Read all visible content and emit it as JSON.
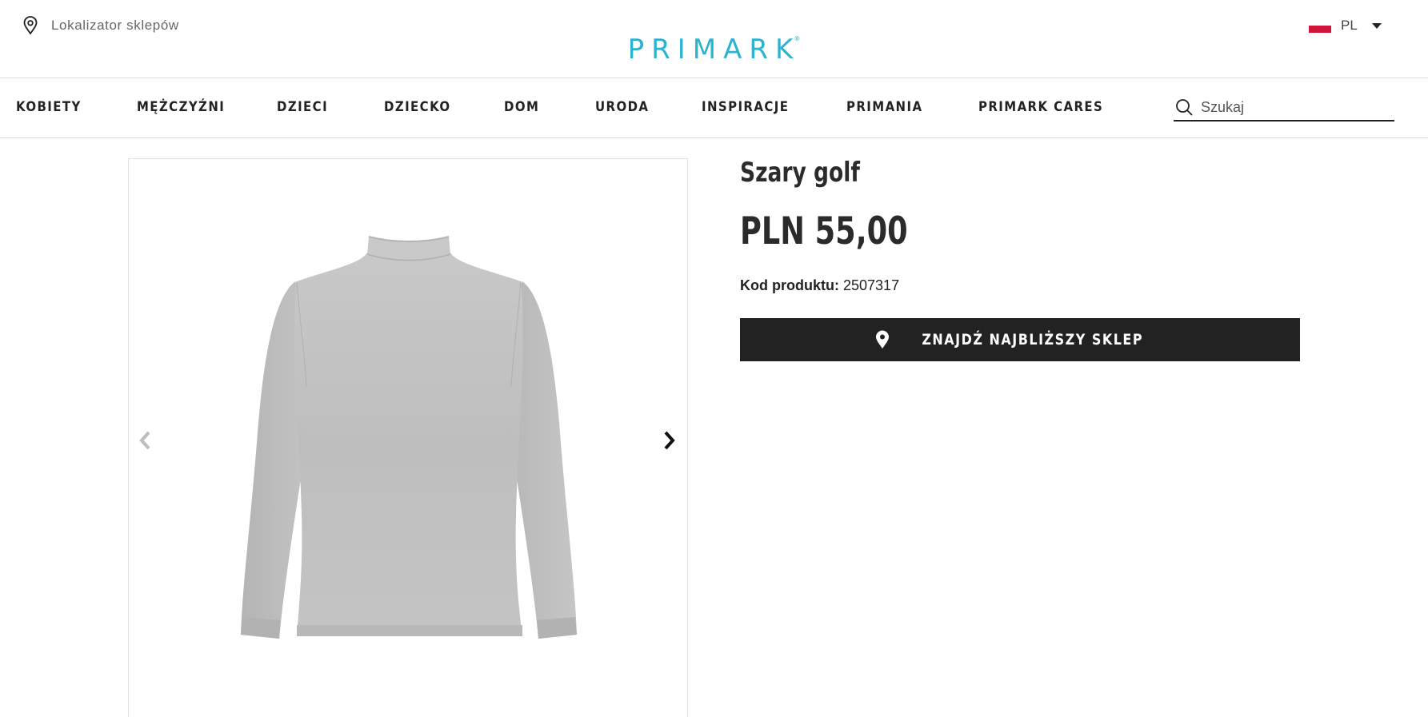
{
  "header": {
    "store_locator_label": "Lokalizator sklepów",
    "logo_text": "PRIMARK",
    "logo_mark": "®",
    "language": "PL",
    "brand_color": "#2bb3cf"
  },
  "nav": {
    "items": [
      {
        "label": "KOBIETY"
      },
      {
        "label": "MĘŻCZYŹNI"
      },
      {
        "label": "DZIECI"
      },
      {
        "label": "DZIECKO"
      },
      {
        "label": "DOM"
      },
      {
        "label": "URODA"
      },
      {
        "label": "INSPIRACJE"
      },
      {
        "label": "PRIMANIA"
      },
      {
        "label": "PRIMARK CARES"
      }
    ],
    "search_placeholder": "Szukaj"
  },
  "product": {
    "title": "Szary golf",
    "price": "PLN 55,00",
    "code_label": "Kod produktu:",
    "code_value": "2507317",
    "cta_label": "ZNAJDŹ NAJBLIŻSZY SKLEP",
    "image_icon": "grey-turtleneck-sweater-image"
  },
  "icons": {
    "store_locator": "map-pin-outline-icon",
    "search": "search-icon",
    "language_caret": "caret-down-icon",
    "gallery_prev": "chevron-left-icon",
    "gallery_next": "chevron-right-icon",
    "cta": "map-pin-filled-icon"
  },
  "colors": {
    "cta_background": "#222222",
    "flag_red": "#d1143a"
  }
}
